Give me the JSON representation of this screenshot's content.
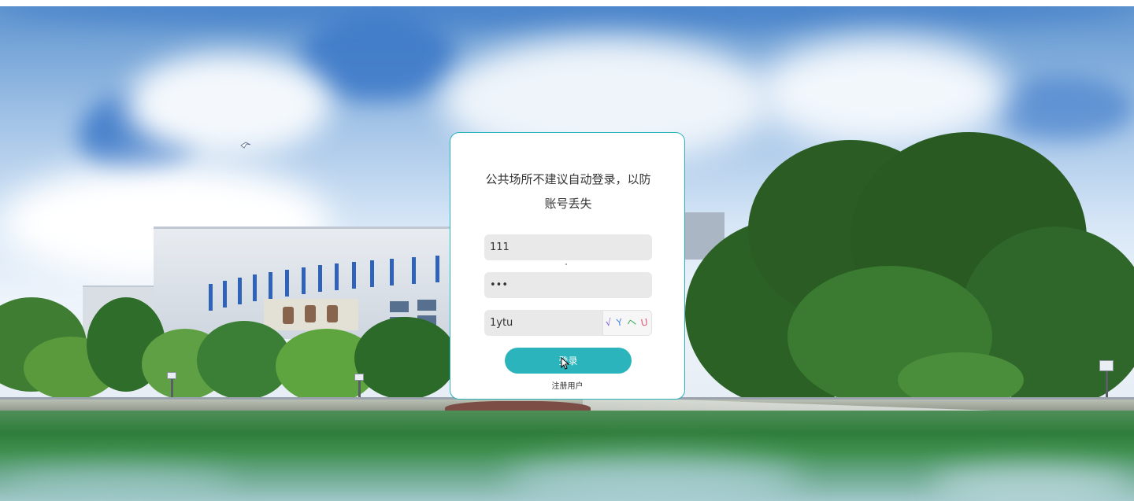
{
  "login": {
    "notice": "公共场所不建议自动登录，以防账号丢失",
    "username_value": "111",
    "password_value": "•••",
    "captcha_value": "1ytu",
    "captcha_image_text": [
      "√",
      "Y",
      "ヘ",
      "U"
    ],
    "submit_label": "登录",
    "register_label": "注册用户"
  },
  "colors": {
    "accent": "#2bb4bb",
    "card_border": "#2ab2bb"
  }
}
